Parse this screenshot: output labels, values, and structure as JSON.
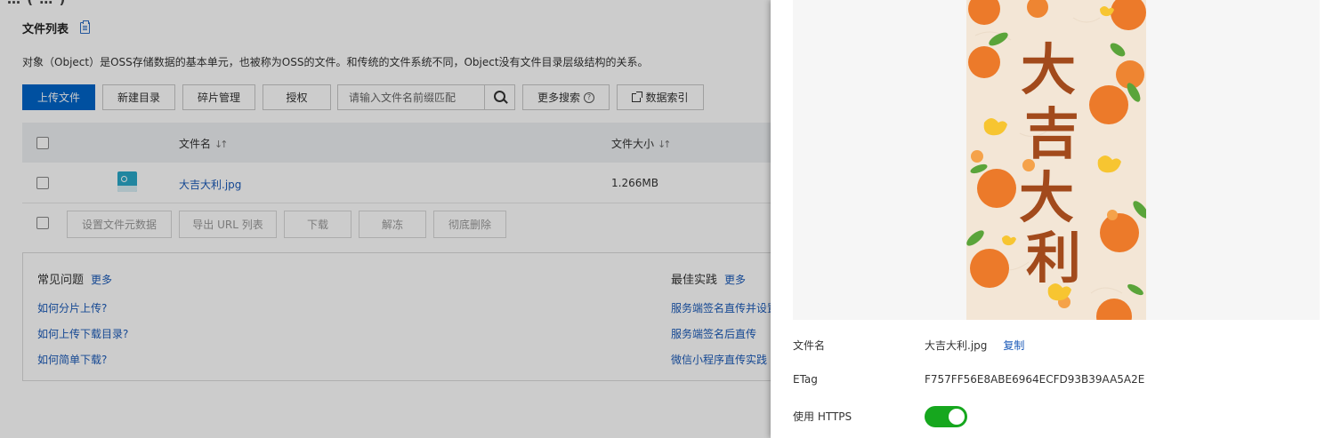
{
  "header": {
    "clipped_title": "… ( … )",
    "section_title": "文件列表",
    "description": "对象（Object）是OSS存储数据的基本单元，也被称为OSS的文件。和传统的文件系统不同，Object没有文件目录层级结构的关系。"
  },
  "toolbar": {
    "upload": "上传文件",
    "new_dir": "新建目录",
    "fragments": "碎片管理",
    "authorize": "授权",
    "search_placeholder": "请输入文件名前缀匹配",
    "more_search": "更多搜索",
    "data_index": "数据索引"
  },
  "table": {
    "headers": {
      "name": "文件名",
      "size": "文件大小"
    },
    "rows": [
      {
        "name": "大吉大利.jpg",
        "size": "1.266MB"
      }
    ]
  },
  "bulk_actions": {
    "set_meta": "设置文件元数据",
    "export_url": "导出 URL 列表",
    "download": "下载",
    "unfreeze": "解冻",
    "delete": "彻底删除"
  },
  "faq": {
    "title": "常见问题",
    "more": "更多",
    "links": [
      "如何分片上传?",
      "如何上传下载目录?",
      "如何简单下载?"
    ]
  },
  "best_practice": {
    "title": "最佳实践",
    "more": "更多",
    "links": [
      "服务端签名直传并设置",
      "服务端签名后直传",
      "微信小程序直传实践"
    ]
  },
  "drawer": {
    "poster_text": [
      "大",
      "吉",
      "大",
      "利"
    ],
    "filename_label": "文件名",
    "filename": "大吉大利.jpg",
    "copy": "复制",
    "etag_label": "ETag",
    "etag": "F757FF56E8ABE6964ECFD93B39AA5A2E",
    "https_label": "使用 HTTPS",
    "https_enabled": true
  },
  "colors": {
    "primary": "#0064c8",
    "link": "#1b5ab8",
    "toggle_on": "#16a71e",
    "poster_bg": "#f3e6d6",
    "poster_text": "#a24a1c",
    "orange": "#ec7a2a"
  }
}
